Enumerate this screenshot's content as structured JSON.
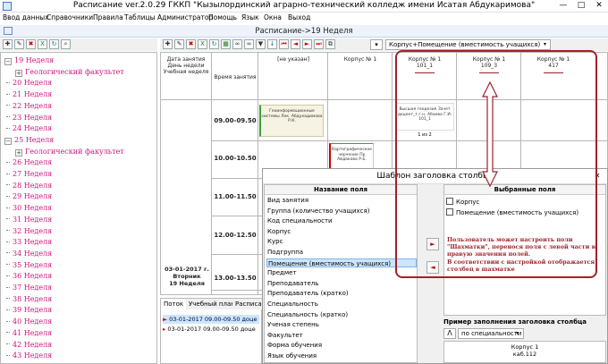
{
  "window": {
    "title": "Расписание ver.2.0.29 ГККП \"Кызылординский аграрно-технический колледж имени Исатая Абдукаримова\"",
    "minimize": "—",
    "maximize": "□",
    "close": "✕"
  },
  "menu": [
    "Ввод данных",
    "Справочники",
    "Правила",
    "Таблицы",
    "Администратор",
    "Помощь",
    "Язык",
    "Окна",
    "Выход"
  ],
  "document": {
    "title": "Расписание->19 Неделя"
  },
  "toolbar": {
    "left_icons": [
      "new",
      "edit",
      "delete",
      "excel",
      "refresh",
      "search"
    ],
    "right_icons": [
      "new",
      "edit",
      "delete",
      "excel",
      "refresh",
      "excel-export",
      "binoculars",
      "binoculars-next",
      "filter",
      "download",
      "first",
      "prev",
      "next",
      "last",
      "copy"
    ],
    "column_select": "Корпус+Помещение (вместимость учащихся)"
  },
  "tree": [
    {
      "label": "19 Неделя",
      "expanded": true,
      "level": 0
    },
    {
      "label": "Геологический факультет",
      "level": 1
    },
    {
      "label": "20 Неделя",
      "level": 0
    },
    {
      "label": "21 Неделя",
      "level": 0
    },
    {
      "label": "22 Неделя",
      "level": 0
    },
    {
      "label": "23 Неделя",
      "level": 0
    },
    {
      "label": "24 Неделя",
      "level": 0
    },
    {
      "label": "25 Неделя",
      "expanded": true,
      "level": 0
    },
    {
      "label": "Геологический факультет",
      "level": 1
    },
    {
      "label": "26 Неделя",
      "level": 0
    },
    {
      "label": "27 Неделя",
      "level": 0
    },
    {
      "label": "28 Неделя",
      "level": 0
    },
    {
      "label": "29 Неделя",
      "level": 0
    },
    {
      "label": "30 Неделя",
      "level": 0
    },
    {
      "label": "31 Неделя",
      "level": 0
    },
    {
      "label": "32 Неделя",
      "level": 0
    },
    {
      "label": "33 Неделя",
      "level": 0
    },
    {
      "label": "34 Неделя",
      "level": 0
    },
    {
      "label": "35 Неделя",
      "level": 0
    },
    {
      "label": "36 Неделя",
      "level": 0
    },
    {
      "label": "37 Неделя",
      "level": 0
    },
    {
      "label": "38 Неделя",
      "level": 0
    },
    {
      "label": "39 Неделя",
      "level": 0
    },
    {
      "label": "40 Неделя",
      "level": 0
    },
    {
      "label": "41 Неделя",
      "level": 0
    },
    {
      "label": "42 Неделя",
      "level": 0
    },
    {
      "label": "43 Неделя",
      "level": 0
    }
  ],
  "grid": {
    "header_date": "Дата занятия\nДень недели\nУчебная неделя",
    "header_time": "Время занятия",
    "col_unspecified": "[не указан]",
    "col_corpus1": "Корпус № 1",
    "col_room1": "Корпус № 1\n101_1",
    "col_room2": "Корпус № 1\n109_3",
    "col_room3": "Корпус № 1\n417",
    "times": [
      "09.00-09.50",
      "10.00-10.50",
      "11.00-11.50",
      "12.00-12.50",
      "13.00-13.50"
    ],
    "date_cell": "03-01-2017 г.\nВторник\n19 Неделя",
    "lesson1": "Геоинформационные системы Лек. Абдукадимова Р.К.",
    "lesson2": "Высшая геодезия Зачет доцент_т.г.н. Абаева Г.И. 101_1",
    "lesson2_pager": "1 из 2",
    "lesson3": "Картографическое черчение Пр Айдакова Р.Б."
  },
  "bottom": {
    "tabs": [
      "Поток",
      "Учебный план",
      "Расписа"
    ],
    "rows": [
      "03-01-2017 09.00-09.50  доце",
      "03-01-2017 09.00-09.50  доце"
    ]
  },
  "dialog": {
    "title": "Шаблон заголовка столбца",
    "left_header": "Название поля",
    "right_header": "Выбранные поля",
    "fields": [
      "Вид занятия",
      "Группа (количество учащихся)",
      "Код специальности",
      "Корпус",
      "Курс",
      "Подгруппа",
      "Помещение (вместимость учащихся)",
      "Предмет",
      "Преподаватель",
      "Преподаватель (кратко)",
      "Специальность",
      "Специальность (кратко)",
      "Ученая степень",
      "Факультет",
      "Форма обучения",
      "Язык обучения"
    ],
    "selected_index": 6,
    "selected_fields": [
      "Корпус",
      "Помещение (вместимость учащихся)"
    ],
    "move_right": "►",
    "move_left": "◄",
    "example_label": "Пример заполнения заголовка столбца",
    "example_sort": "по специальности",
    "example_text": "Корпус 1\nкаб.112"
  },
  "annotation": {
    "lines": [
      "Пользователь может настроить поли",
      "\"Шахматки\", перенося поля с левой части в",
      "правую значения полей.",
      "В соответствии с настройкой отображается",
      "столбец в шахматке"
    ],
    "color": "#a0222a"
  },
  "colors": {
    "tree_text": "#d0127a",
    "accent_red": "#a0222a",
    "selection": "#cce6ff"
  }
}
